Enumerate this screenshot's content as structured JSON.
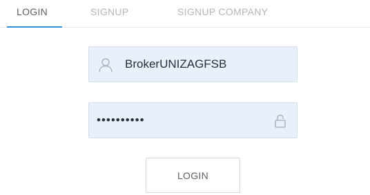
{
  "tabs": [
    {
      "label": "LOGIN",
      "active": true
    },
    {
      "label": "SIGNUP",
      "active": false
    },
    {
      "label": "SIGNUP COMPANY",
      "active": false
    }
  ],
  "form": {
    "username": {
      "value": "BrokerUNIZAGFSB",
      "icon": "user-icon"
    },
    "password": {
      "value": "••••••••••",
      "icon": "lock-icon"
    },
    "submit_label": "LOGIN"
  },
  "colors": {
    "accent": "#2f8fd6",
    "field_background": "#e8f0fe",
    "tab_inactive": "#b3b6bb",
    "tab_active": "#5d6167"
  }
}
